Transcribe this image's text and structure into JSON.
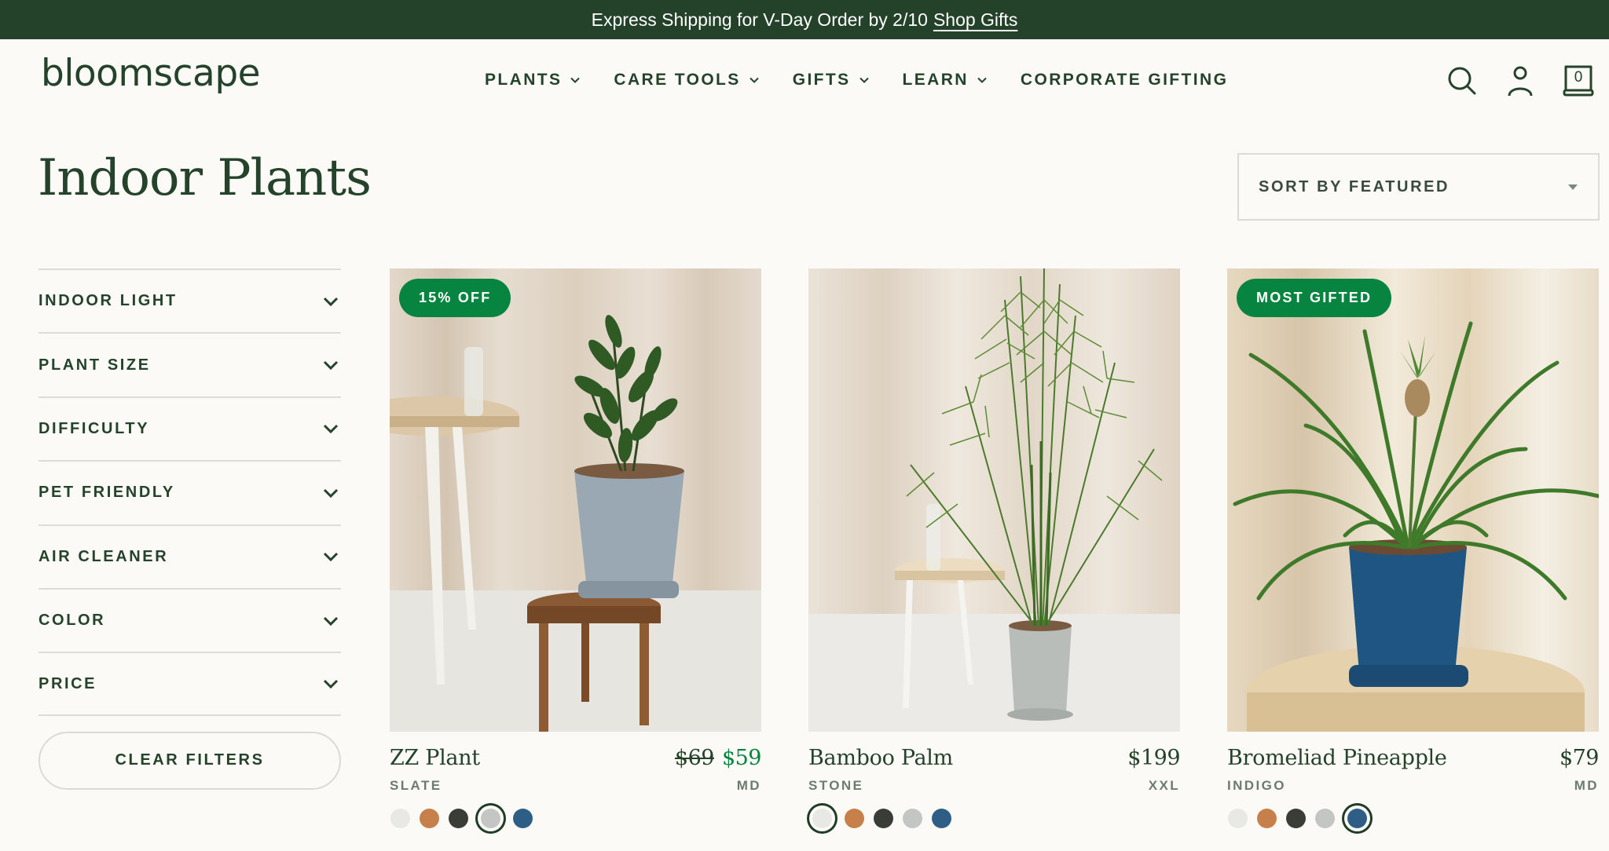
{
  "promo_bar": {
    "text": "Express Shipping for V-Day Order by 2/10",
    "link": "Shop Gifts"
  },
  "header": {
    "logo": "bloomscape",
    "nav": [
      {
        "label": "PLANTS",
        "has_dropdown": true
      },
      {
        "label": "CARE TOOLS",
        "has_dropdown": true
      },
      {
        "label": "GIFTS",
        "has_dropdown": true
      },
      {
        "label": "LEARN",
        "has_dropdown": true
      },
      {
        "label": "CORPORATE GIFTING",
        "has_dropdown": false
      }
    ],
    "icons": [
      "search-icon",
      "account-icon",
      "cart-icon"
    ],
    "cart_count": "0"
  },
  "page": {
    "title": "Indoor Plants",
    "sort_label": "SORT BY FEATURED"
  },
  "filters": {
    "items": [
      {
        "label": "INDOOR LIGHT"
      },
      {
        "label": "PLANT SIZE"
      },
      {
        "label": "DIFFICULTY"
      },
      {
        "label": "PET FRIENDLY"
      },
      {
        "label": "AIR CLEANER"
      },
      {
        "label": "COLOR"
      },
      {
        "label": "PRICE"
      }
    ],
    "clear_label": "CLEAR FILTERS"
  },
  "colors": {
    "brand_dark": "#244229",
    "accent_green": "#07843f",
    "background": "#fcfaf6",
    "swatch_colors": [
      "#e8e8e4",
      "#c8804a",
      "#3a3d36",
      "#c4c6c4",
      "#2e5e85"
    ]
  },
  "products": [
    {
      "name": "ZZ Plant",
      "badge": "15% OFF",
      "price_original": "$69",
      "price": "$59",
      "color_name": "SLATE",
      "size": "MD",
      "selected_swatch": 3
    },
    {
      "name": "Bamboo Palm",
      "badge": "",
      "price_original": "",
      "price": "$199",
      "color_name": "STONE",
      "size": "XXL",
      "selected_swatch": 0
    },
    {
      "name": "Bromeliad Pineapple",
      "badge": "MOST GIFTED",
      "price_original": "",
      "price": "$79",
      "color_name": "INDIGO",
      "size": "MD",
      "selected_swatch": 4
    }
  ]
}
